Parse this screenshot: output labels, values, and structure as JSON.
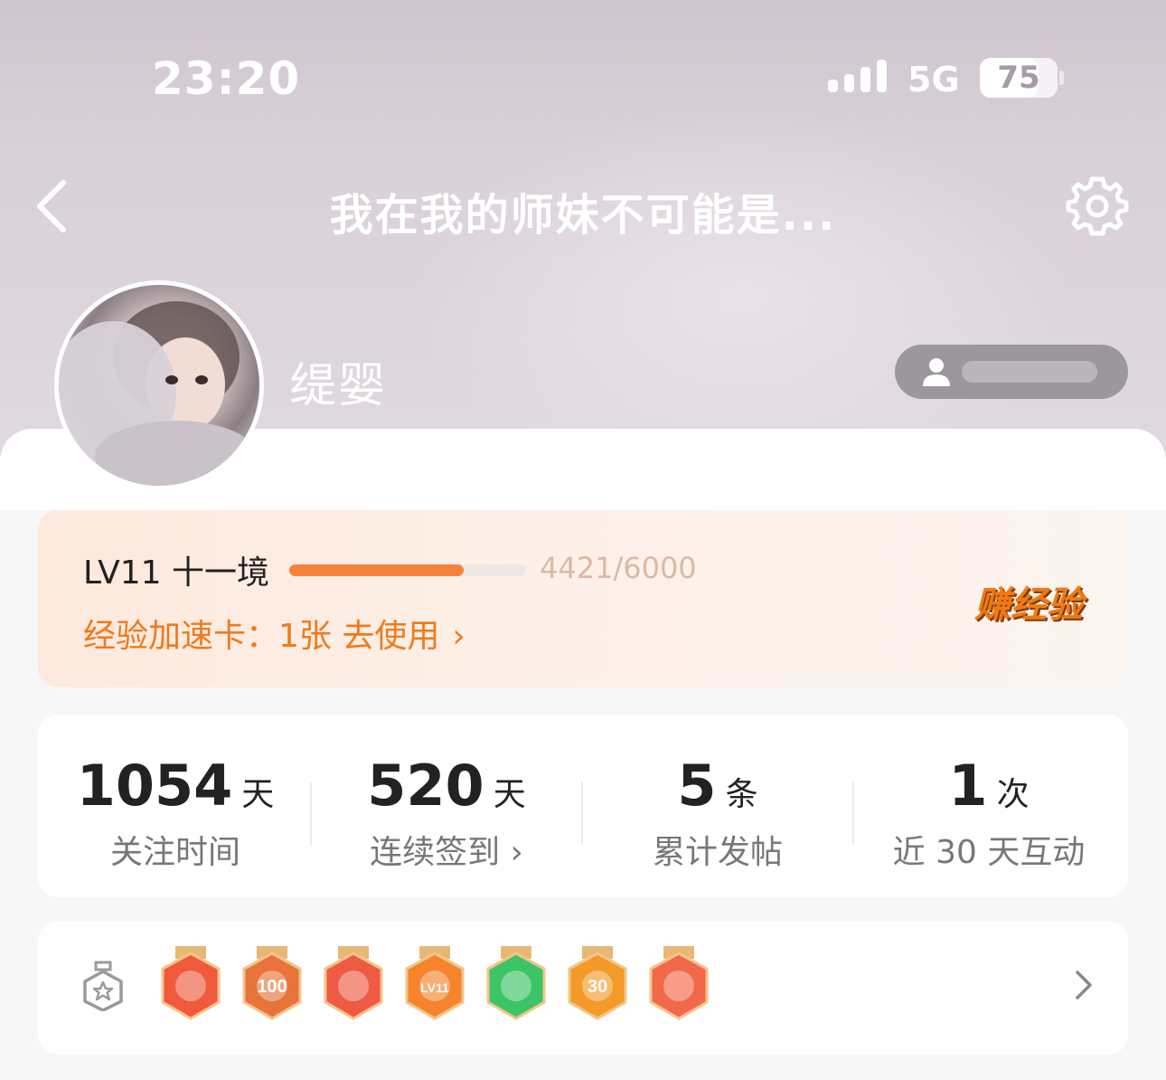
{
  "status_bar": {
    "time": "23:20",
    "network": "5G",
    "battery": "75",
    "battery_level": 0.75
  },
  "header": {
    "title": "我在我的师妹不可能是...",
    "back_icon": "chevron-left-icon",
    "settings_icon": "gear-icon"
  },
  "profile": {
    "username": "缇婴",
    "avatar_icon": "avatar",
    "follow_icon": "user-icon"
  },
  "level": {
    "label": "LV11 十一境",
    "progress_text": "4421/6000",
    "progress_fraction": 0.7368,
    "boost_text": "经验加速卡：1张  去使用",
    "earn_button": "赚经验",
    "accent_color": "#f6823a"
  },
  "stats": [
    {
      "value": "1054",
      "unit": "天",
      "label": "关注时间"
    },
    {
      "value": "520",
      "unit": "天",
      "label": "连续签到 ›"
    },
    {
      "value": "5",
      "unit": "条",
      "label": "累计发帖"
    },
    {
      "value": "1",
      "unit": "次",
      "label": "近 30 天互动"
    }
  ],
  "badges": {
    "section_icon": "medal-icon",
    "items": [
      {
        "name": "cat-badge",
        "color": "#ef5a3c"
      },
      {
        "name": "100-days-badge",
        "color": "#e8743b",
        "text": "100"
      },
      {
        "name": "cat-badge",
        "color": "#ee5b45"
      },
      {
        "name": "lv11-badge",
        "color": "#f5842c",
        "text": "LV11"
      },
      {
        "name": "hand-badge",
        "color": "#3cc467"
      },
      {
        "name": "30-days-badge",
        "color": "#f39a28",
        "text": "30"
      },
      {
        "name": "rock-hand-badge",
        "color": "#f2684a"
      }
    ]
  }
}
